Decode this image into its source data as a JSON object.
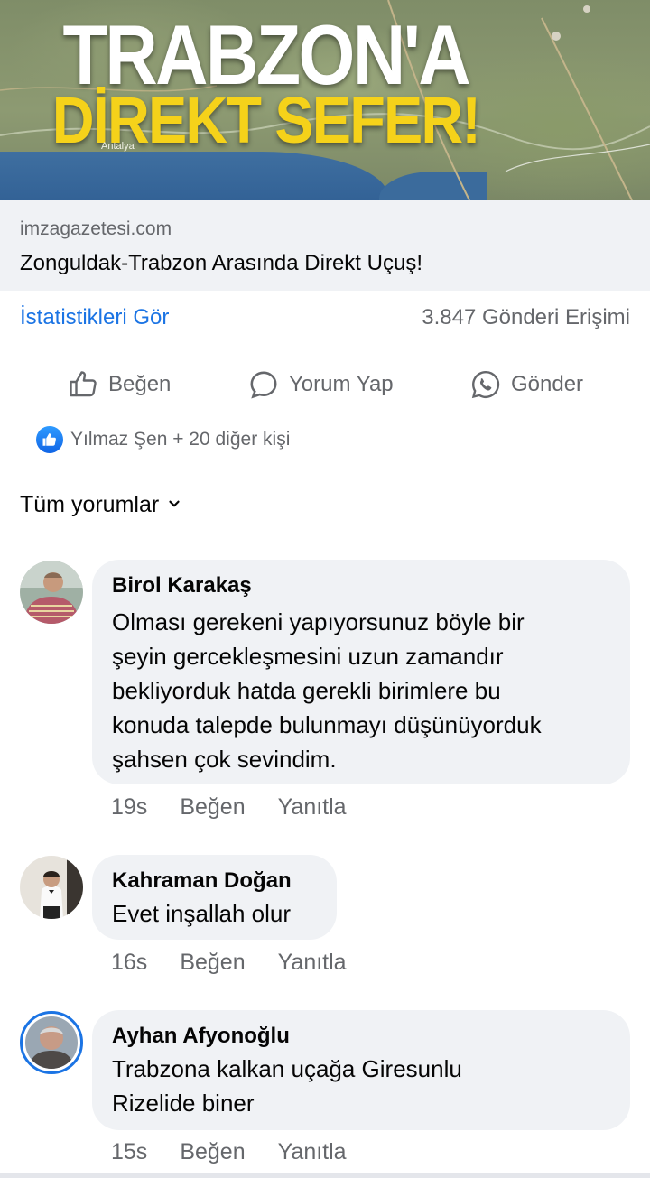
{
  "hero": {
    "headline": "TRABZON'A",
    "subheadline": "DİREKT SEFER!",
    "map_label": "Antalya"
  },
  "link": {
    "domain": "imzagazetesi.com",
    "title": "Zonguldak-Trabzon Arasında Direkt Uçuş!"
  },
  "stats": {
    "insights_label": "İstatistikleri Gör",
    "reach_label": "3.847 Gönderi Erişimi"
  },
  "actions": {
    "like_label": "Beğen",
    "comment_label": "Yorum Yap",
    "send_label": "Gönder"
  },
  "reactions": {
    "summary": "Yılmaz Şen + 20 diğer kişi"
  },
  "comments_header": {
    "label": "Tüm yorumlar"
  },
  "comments": [
    {
      "author": "Birol Karakaş",
      "lines": [
        "Olması gerekeni yapıyorsunuz böyle bir",
        "şeyin gercekleşmesini uzun zamandır",
        "bekliyorduk hatda gerekli birimlere bu",
        "konuda talepde bulunmayı düşünüyorduk",
        "şahsen çok sevindim."
      ],
      "time": "19s",
      "like_label": "Beğen",
      "reply_label": "Yanıtla"
    },
    {
      "author": "Kahraman Doğan",
      "lines": [
        "Evet inşallah olur"
      ],
      "time": "16s",
      "like_label": "Beğen",
      "reply_label": "Yanıtla"
    },
    {
      "author": "Ayhan Afyonoğlu",
      "lines": [
        "Trabzona kalkan uçağa Giresunlu",
        "Rizelide biner"
      ],
      "time": "15s",
      "like_label": "Beğen",
      "reply_label": "Yanıtla"
    }
  ],
  "colors": {
    "link_blue": "#1b74e4",
    "muted_text": "#65676b",
    "bubble_bg": "#f0f2f5",
    "headline_yellow": "#f5d21a"
  }
}
